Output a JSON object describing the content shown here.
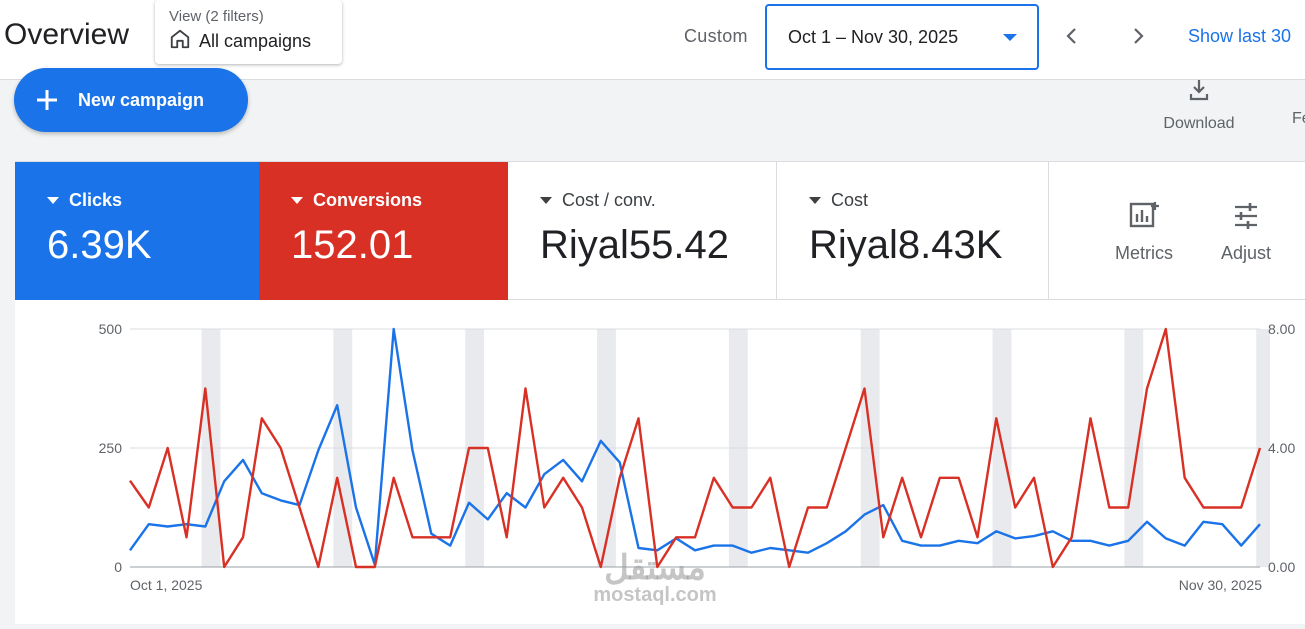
{
  "header": {
    "title": "Overview",
    "filter_top": "View (2 filters)",
    "filter_main": "All campaigns",
    "range_label": "Custom",
    "date_range": "Oct 1 – Nov 30, 2025",
    "show_last": "Show last 30"
  },
  "toolbar": {
    "new_campaign": "New campaign",
    "download": "Download",
    "fe": "Fe"
  },
  "metrics": [
    {
      "name": "Clicks",
      "value": "6.39K",
      "color": "#1a73e8"
    },
    {
      "name": "Conversions",
      "value": "152.01",
      "color": "#d93025"
    },
    {
      "name": "Cost / conv.",
      "value": "Riyal55.42"
    },
    {
      "name": "Cost",
      "value": "Riyal8.43K"
    }
  ],
  "tools": {
    "metrics": "Metrics",
    "adjust": "Adjust"
  },
  "watermark": {
    "arabic": "مستقل",
    "latin": "mostaql.com"
  },
  "chart_data": {
    "type": "line",
    "x_start_label": "Oct 1, 2025",
    "x_end_label": "Nov 30, 2025",
    "left_ticks": [
      "0",
      "250",
      "500"
    ],
    "right_ticks": [
      "0.00",
      "4.00",
      "8.00"
    ],
    "left_ylim": [
      0,
      500
    ],
    "right_ylim": [
      0,
      8
    ],
    "weekend_bands_start_days": [
      4,
      11,
      18,
      25,
      32,
      39,
      46,
      53,
      60
    ],
    "series": [
      {
        "axis": "left",
        "color": "#1a73e8",
        "values": [
          35,
          90,
          85,
          90,
          85,
          180,
          225,
          155,
          140,
          130,
          245,
          340,
          125,
          5,
          500,
          245,
          70,
          45,
          135,
          100,
          155,
          125,
          195,
          225,
          180,
          265,
          220,
          40,
          35,
          60,
          35,
          45,
          45,
          30,
          40,
          35,
          30,
          50,
          75,
          110,
          130,
          55,
          45,
          45,
          55,
          50,
          75,
          60,
          65,
          75,
          55,
          55,
          45,
          55,
          95,
          60,
          45,
          95,
          90,
          45,
          90
        ]
      },
      {
        "axis": "right",
        "color": "#d93025",
        "values": [
          2.9,
          2.0,
          4.0,
          1.0,
          6.0,
          0.0,
          1.0,
          5.0,
          4.0,
          2.0,
          0.0,
          3.0,
          0.0,
          0.0,
          3.0,
          1.0,
          1.0,
          1.0,
          4.0,
          4.0,
          1.0,
          6.0,
          2.0,
          3.0,
          2.0,
          0.0,
          3.0,
          5.0,
          0.0,
          1.0,
          1.0,
          3.0,
          2.0,
          2.0,
          3.0,
          0.0,
          2.0,
          2.0,
          4.0,
          6.0,
          1.0,
          3.0,
          1.0,
          3.0,
          3.0,
          1.0,
          5.0,
          2.0,
          3.0,
          0.0,
          1.0,
          5.0,
          2.0,
          2.0,
          6.0,
          8.0,
          3.0,
          2.0,
          2.0,
          2.0,
          4.0
        ]
      }
    ]
  }
}
